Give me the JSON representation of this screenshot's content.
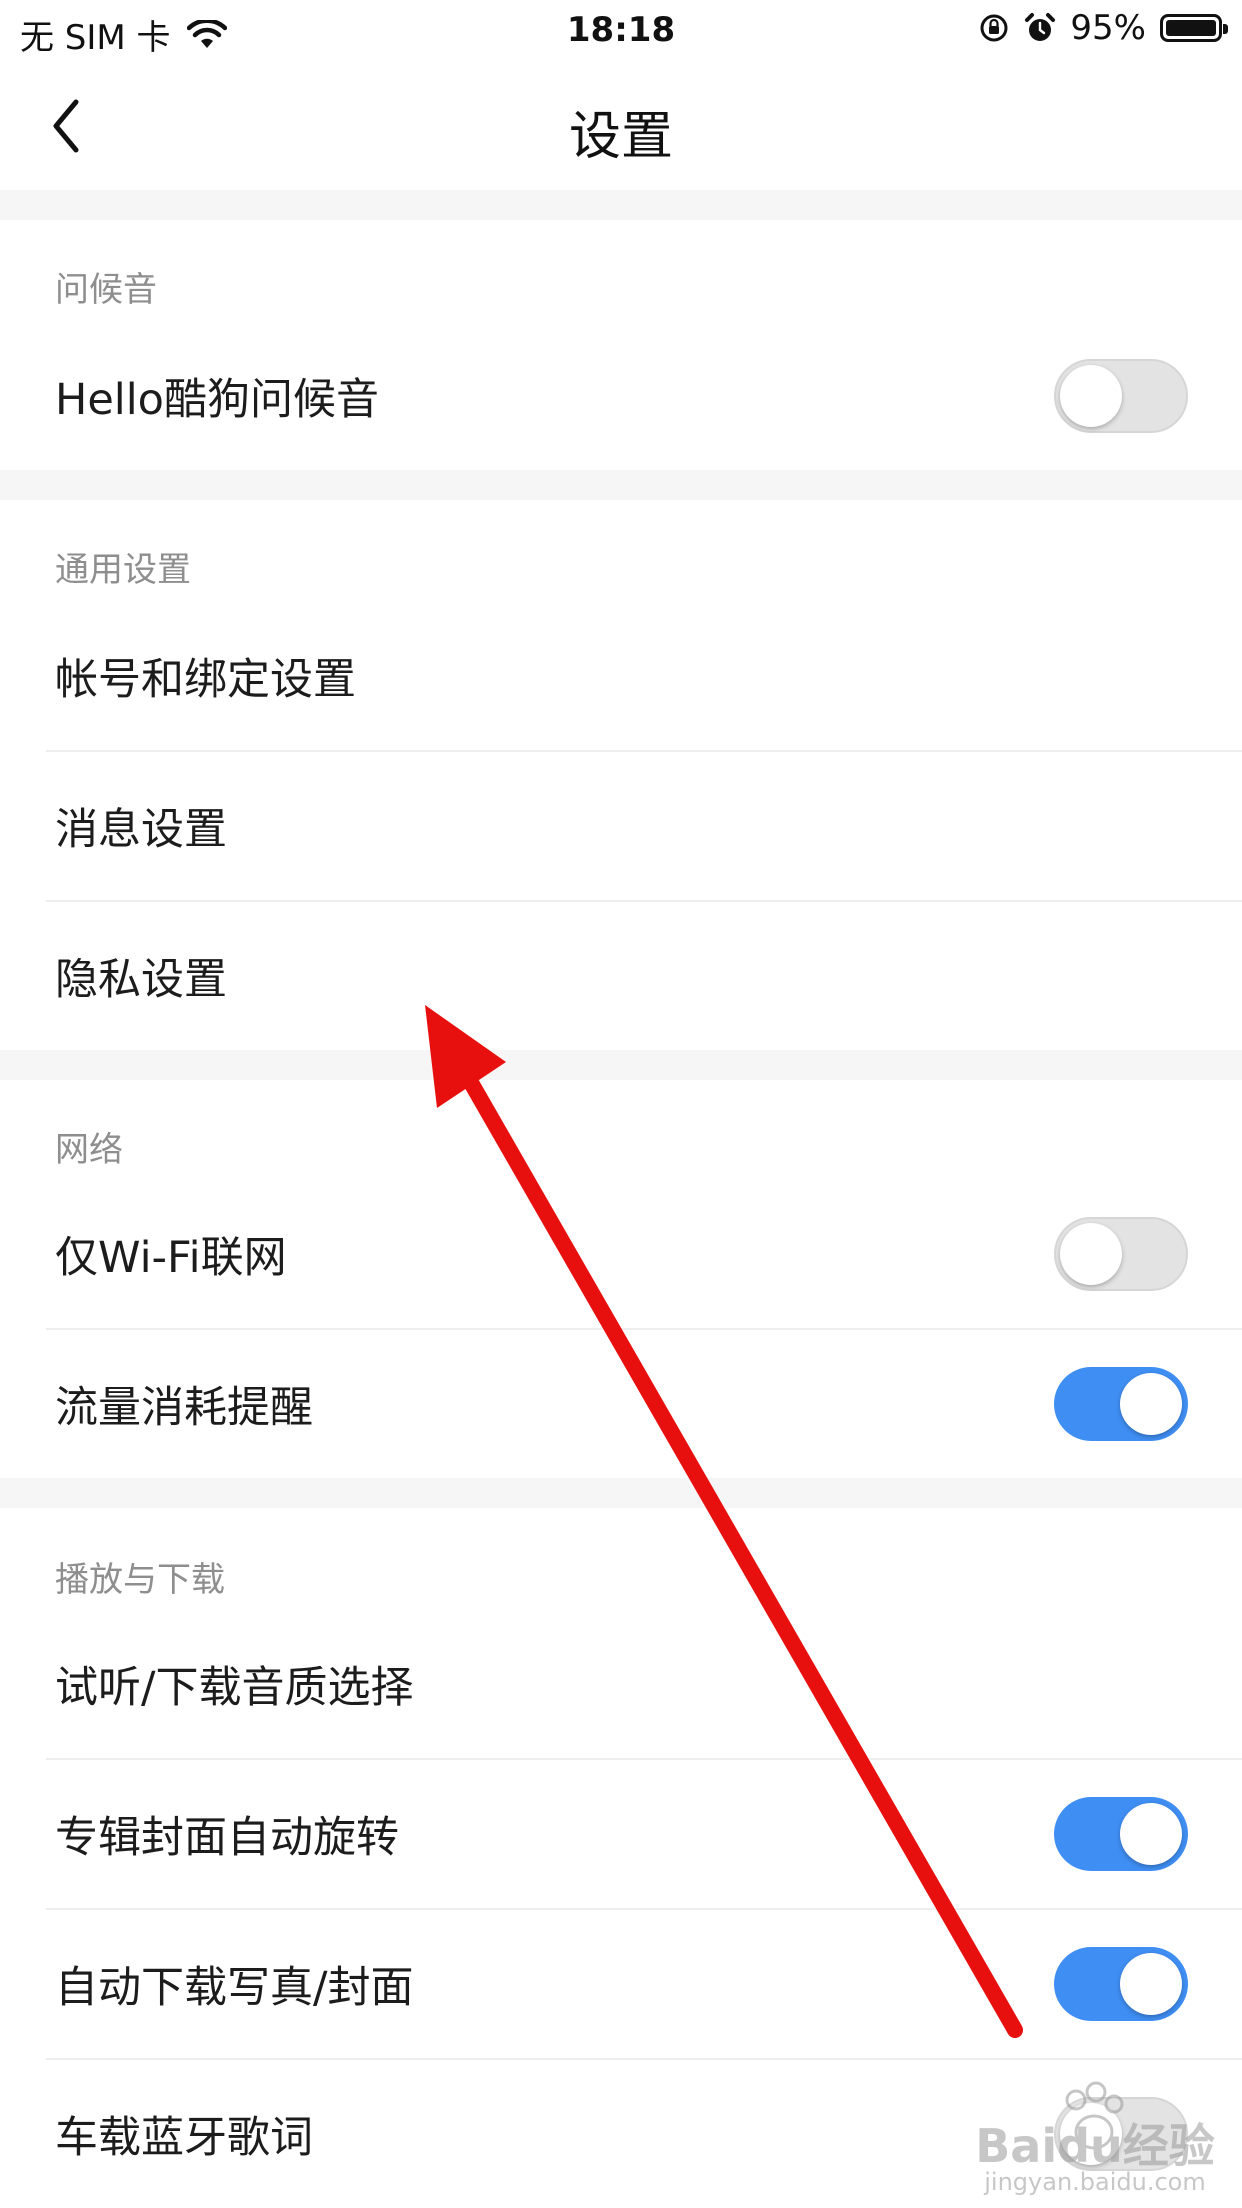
{
  "status_bar": {
    "carrier": "无 SIM 卡",
    "time": "18:18",
    "battery": "95%",
    "battery_level": 0.95
  },
  "nav": {
    "title": "设置"
  },
  "sections": {
    "greeting": {
      "header": "问候音",
      "items": [
        {
          "label": "Hello酷狗问候音",
          "toggle": false
        }
      ]
    },
    "general": {
      "header": "通用设置",
      "items": [
        {
          "label": "帐号和绑定设置"
        },
        {
          "label": "消息设置"
        },
        {
          "label": "隐私设置"
        }
      ]
    },
    "network": {
      "header": "网络",
      "items": [
        {
          "label": "仅Wi-Fi联网",
          "toggle": false
        },
        {
          "label": "流量消耗提醒",
          "toggle": true
        }
      ]
    },
    "playback": {
      "header": "播放与下载",
      "items": [
        {
          "label": "试听/下载音质选择"
        },
        {
          "label": "专辑封面自动旋转",
          "toggle": true
        },
        {
          "label": "自动下载写真/封面",
          "toggle": true
        },
        {
          "label": "车载蓝牙歌词",
          "toggle": false
        }
      ]
    }
  },
  "watermark": {
    "text": "Baidu经验",
    "subtext": "jingyan.baidu.com"
  },
  "colors": {
    "accent": "#3f8ef3",
    "annotation_arrow": "#e8100e",
    "section_bg": "#f6f6f6",
    "header_text": "#8e8e8e"
  }
}
